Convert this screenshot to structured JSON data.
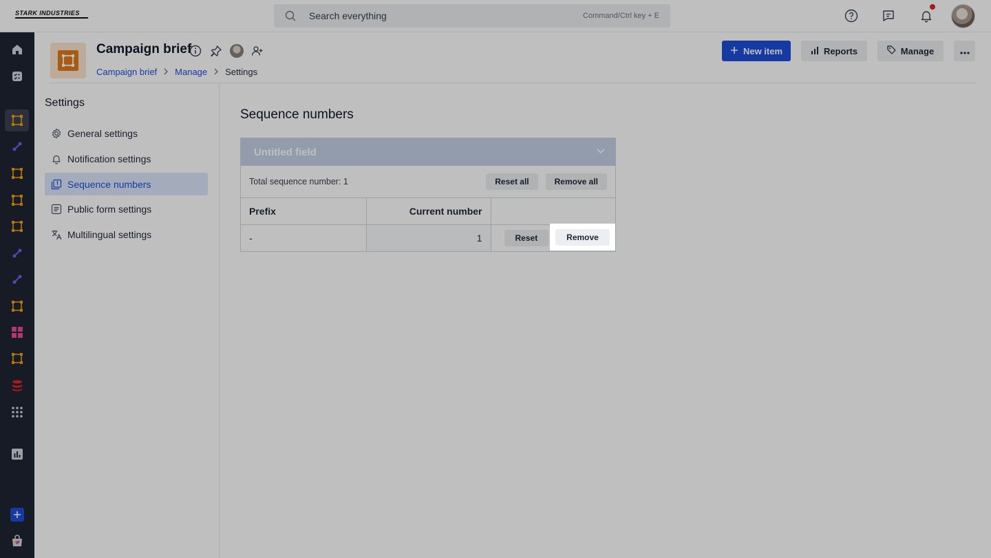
{
  "brand": {
    "logo_text": "STARK INDUSTRIES"
  },
  "search": {
    "placeholder": "Search everything",
    "hint": "Command/Ctrl key + E"
  },
  "project": {
    "title": "Campaign brief"
  },
  "breadcrumb": {
    "items": [
      "Campaign brief",
      "Manage",
      "Settings"
    ]
  },
  "actions": {
    "new_item": "New item",
    "reports": "Reports",
    "manage": "Manage"
  },
  "settings_nav": {
    "title": "Settings",
    "items": [
      {
        "label": "General settings",
        "icon": "gear-icon"
      },
      {
        "label": "Notification settings",
        "icon": "bell-icon"
      },
      {
        "label": "Sequence numbers",
        "icon": "sequence-icon",
        "active": true
      },
      {
        "label": "Public form settings",
        "icon": "form-icon"
      },
      {
        "label": "Multilingual settings",
        "icon": "translate-icon"
      }
    ]
  },
  "sequence": {
    "title": "Sequence numbers",
    "field_name": "Untitled field",
    "total_label": "Total sequence number: 1",
    "reset_all": "Reset all",
    "remove_all": "Remove all",
    "columns": [
      "Prefix",
      "Current number",
      ""
    ],
    "rows": [
      {
        "prefix": "-",
        "current_number": "1",
        "reset": "Reset",
        "remove": "Remove"
      }
    ]
  },
  "colors": {
    "accent": "#1d4ed8",
    "rail": "#1e2433",
    "project_icon": "#e07b1a"
  }
}
